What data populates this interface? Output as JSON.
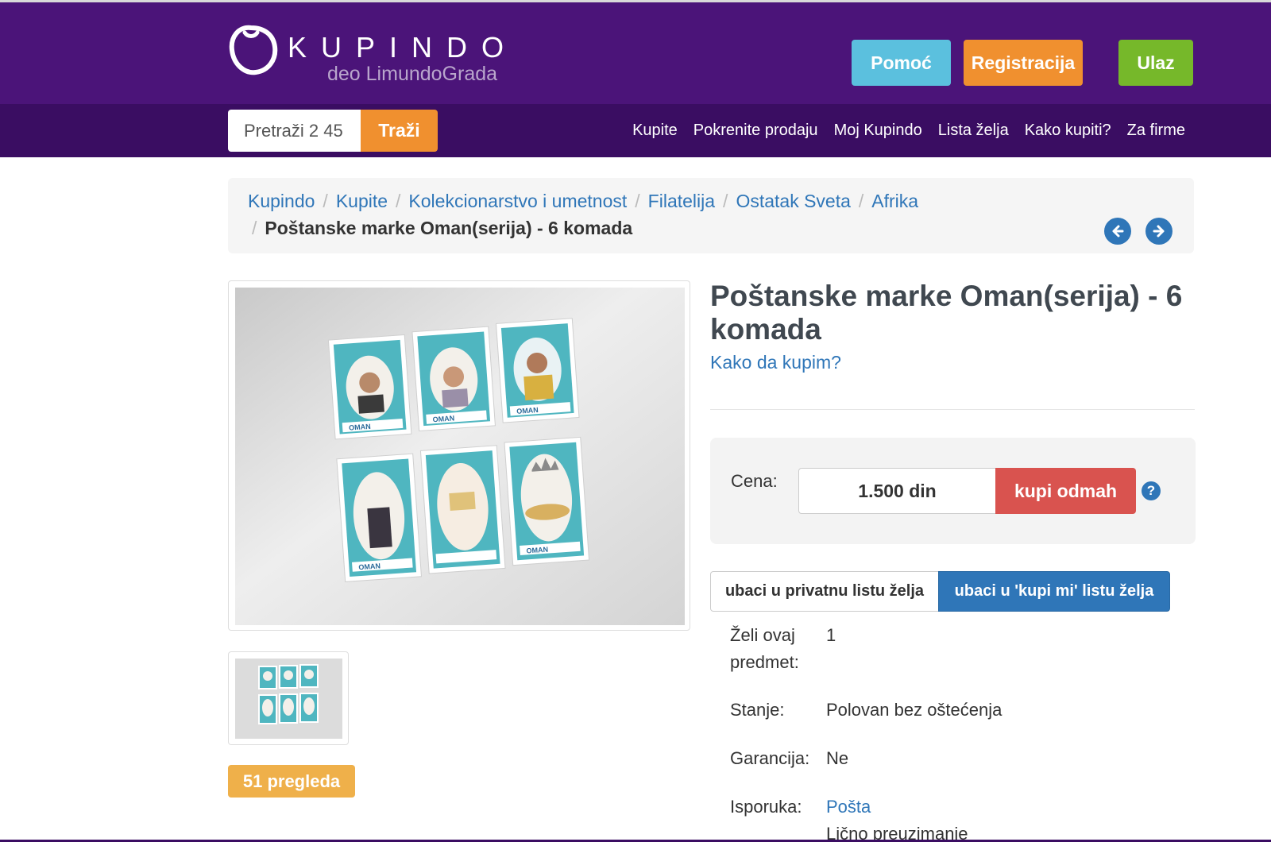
{
  "header": {
    "logo_word": "KUPINDO",
    "logo_sub": "deo LimundoGrada",
    "help_label": "Pomoć",
    "register_label": "Registracija",
    "login_label": "Ulaz"
  },
  "navbar": {
    "search_placeholder": "Pretraži 2 45",
    "search_button": "Traži",
    "links": [
      "Kupite",
      "Pokrenite prodaju",
      "Moj Kupindo",
      "Lista želja",
      "Kako kupiti?",
      "Za firme"
    ]
  },
  "breadcrumb": {
    "items": [
      "Kupindo",
      "Kupite",
      "Kolekcionarstvo i umetnost",
      "Filatelija",
      "Ostatak Sveta",
      "Afrika"
    ],
    "current": "Poštanske marke Oman(serija) - 6 komada",
    "separator": "/"
  },
  "product": {
    "title": "Poštanske marke Oman(serija) - 6 komada",
    "how_to_buy": "Kako da kupim?",
    "views": "51 pregleda",
    "price_label": "Cena:",
    "price": "1.500 din",
    "buy_label": "kupi odmah",
    "help_glyph": "?",
    "wish_private": "ubaci u privatnu listu želja",
    "wish_buyme": "ubaci u 'kupi mi' listu želja",
    "specs": {
      "wants_label_1": "Želi ovaj",
      "wants_label_2": "predmet:",
      "wants_value": "1",
      "condition_label": "Stanje:",
      "condition_value": "Polovan bez oštećenja",
      "warranty_label": "Garancija:",
      "warranty_value": "Ne",
      "delivery_label": "Isporuka:",
      "delivery_value_1": "Pošta",
      "delivery_value_2": "Lično preuzimanje"
    }
  },
  "stamp_texts": {
    "country": "OMAN"
  },
  "colors": {
    "header_bg": "#4b1479",
    "navbar_bg": "#3a0d62",
    "help_btn": "#5bc0de",
    "register_btn": "#f0902f",
    "login_btn": "#76b82a",
    "link_blue": "#2f76b8",
    "buy_red": "#d9534f",
    "badge_gold": "#efb04a"
  }
}
